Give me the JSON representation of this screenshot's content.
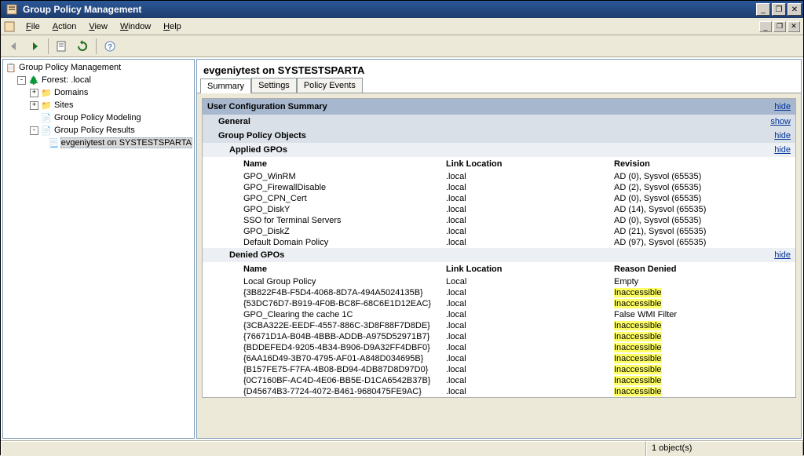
{
  "window": {
    "title": "Group Policy Management",
    "min": "_",
    "max": "❐",
    "close": "✕",
    "mdi_min": "_",
    "mdi_restore": "❐",
    "mdi_close": "✕"
  },
  "menu": {
    "file": "File",
    "action": "Action",
    "view": "View",
    "window": "Window",
    "help": "Help"
  },
  "tree": {
    "root": "Group Policy Management",
    "forest": "Forest:        .local",
    "domains": "Domains",
    "sites": "Sites",
    "modeling": "Group Policy Modeling",
    "results": "Group Policy Results",
    "result_item": "evgeniytest on SYSTESTSPARTA"
  },
  "detail": {
    "header": "evgeniytest on SYSTESTSPARTA",
    "tabs": {
      "summary": "Summary",
      "settings": "Settings",
      "policy_events": "Policy Events"
    }
  },
  "sections": {
    "user_cfg": "User Configuration Summary",
    "general": "General",
    "gpo": "Group Policy Objects",
    "applied": "Applied GPOs",
    "denied": "Denied GPOs",
    "hide": "hide",
    "show": "show"
  },
  "applied_cols": {
    "name": "Name",
    "loc": "Link Location",
    "rev": "Revision"
  },
  "applied_rows": [
    {
      "name": "GPO_WinRM",
      "loc": ".local",
      "rev": "AD (0), Sysvol (65535)"
    },
    {
      "name": "GPO_FirewallDisable",
      "loc": ".local",
      "rev": "AD (2), Sysvol (65535)"
    },
    {
      "name": "GPO_CPN_Cert",
      "loc": ".local",
      "rev": "AD (0), Sysvol (65535)"
    },
    {
      "name": "GPO_DiskY",
      "loc": ".local",
      "rev": "AD (14), Sysvol (65535)"
    },
    {
      "name": "SSO for Terminal Servers",
      "loc": ".local",
      "rev": "AD (0), Sysvol (65535)"
    },
    {
      "name": "GPO_DiskZ",
      "loc": ".local",
      "rev": "AD (21), Sysvol (65535)"
    },
    {
      "name": "Default Domain Policy",
      "loc": ".local",
      "rev": "AD (97), Sysvol (65535)"
    }
  ],
  "denied_cols": {
    "name": "Name",
    "loc": "Link Location",
    "reason": "Reason Denied"
  },
  "denied_rows": [
    {
      "name": "Local Group Policy",
      "loc": "Local",
      "reason": "Empty",
      "hl": false
    },
    {
      "name": "{3B822F4B-F5D4-4068-8D7A-494A5024135B}",
      "loc": ".local",
      "reason": "Inaccessible",
      "hl": true
    },
    {
      "name": "{53DC76D7-B919-4F0B-BC8F-68C6E1D12EAC}",
      "loc": ".local",
      "reason": "Inaccessible",
      "hl": true
    },
    {
      "name": "GPO_Clearing the cache 1C",
      "loc": ".local",
      "reason": "False WMI Filter",
      "hl": false
    },
    {
      "name": "{3CBA322E-EEDF-4557-886C-3D8F88F7D8DE}",
      "loc": ".local",
      "reason": "Inaccessible",
      "hl": true
    },
    {
      "name": "{76671D1A-B04B-4BBB-ADDB-A975D52971B7}",
      "loc": ".local",
      "reason": "Inaccessible",
      "hl": true
    },
    {
      "name": "{BDDEFED4-9205-4B34-B906-D9A32FF4DBF0}",
      "loc": ".local",
      "reason": "Inaccessible",
      "hl": true
    },
    {
      "name": "{6AA16D49-3B70-4795-AF01-A848D034695B}",
      "loc": ".local",
      "reason": "Inaccessible",
      "hl": true
    },
    {
      "name": "{B157FE75-F7FA-4B08-BD94-4DB87D8D97D0}",
      "loc": ".local",
      "reason": "Inaccessible",
      "hl": true
    },
    {
      "name": "{0C7160BF-AC4D-4E06-BB5E-D1CA6542B37B}",
      "loc": ".local",
      "reason": "Inaccessible",
      "hl": true
    },
    {
      "name": "{D45674B3-7724-4072-B461-9680475FE9AC}",
      "loc": ".local",
      "reason": "Inaccessible",
      "hl": true
    }
  ],
  "status": {
    "count": "1 object(s)"
  }
}
